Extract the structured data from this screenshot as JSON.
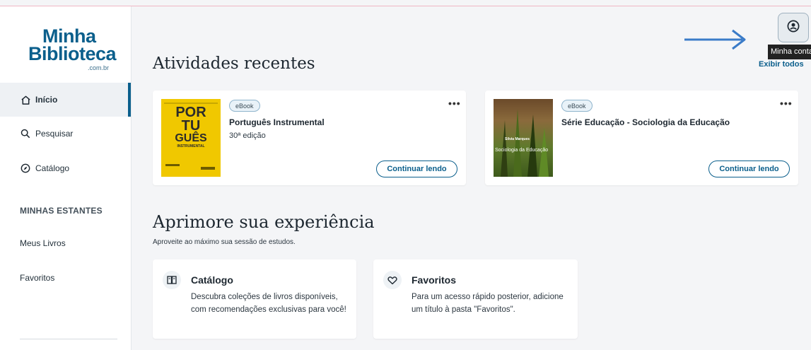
{
  "logo": {
    "line1": "Minha",
    "line2": "Biblioteca",
    "line3": ".com.br"
  },
  "sidebar": {
    "nav": [
      {
        "label": "Início",
        "icon": "home-icon",
        "active": true
      },
      {
        "label": "Pesquisar",
        "icon": "search-icon",
        "active": false
      },
      {
        "label": "Catálogo",
        "icon": "compass-icon",
        "active": false
      }
    ],
    "shelves_heading": "MINHAS ESTANTES",
    "shelves": [
      "Meus Livros",
      "Favoritos"
    ]
  },
  "header": {
    "account_icon": "user-circle-icon",
    "account_tooltip": "Minha conta"
  },
  "recent": {
    "title": "Atividades recentes",
    "see_all": "Exibir todos",
    "books": [
      {
        "badge": "eBook",
        "title": "Português Instrumental",
        "subtitle": "30ª edição",
        "button": "Continuar lendo",
        "menu": "•••",
        "cover": {
          "l1": "POR",
          "l2": "TU",
          "l3": "GUÊS",
          "l4": "INSTRUMENTAL"
        }
      },
      {
        "badge": "eBook",
        "title": "Série Educação - Sociologia da Educação",
        "subtitle": "",
        "button": "Continuar lendo",
        "menu": "•••",
        "cover": {
          "author": "Silvia Marques",
          "title": "Sociologia da Educação"
        }
      }
    ]
  },
  "improve": {
    "title": "Aprimore sua experiência",
    "subtitle": "Aproveite ao máximo sua sessão de estudos.",
    "cards": [
      {
        "icon": "book-open-icon",
        "title": "Catálogo",
        "description": "Descubra coleções de livros disponíveis, com recomendações exclusivas para você!"
      },
      {
        "icon": "heart-icon",
        "title": "Favoritos",
        "description": "Para um acesso rápido posterior, adicione um título à pasta \"Favoritos\"."
      }
    ]
  },
  "colors": {
    "brand": "#0b5f8c",
    "annotation_arrow": "#3a7bc8",
    "cover_yellow": "#f0c800"
  }
}
